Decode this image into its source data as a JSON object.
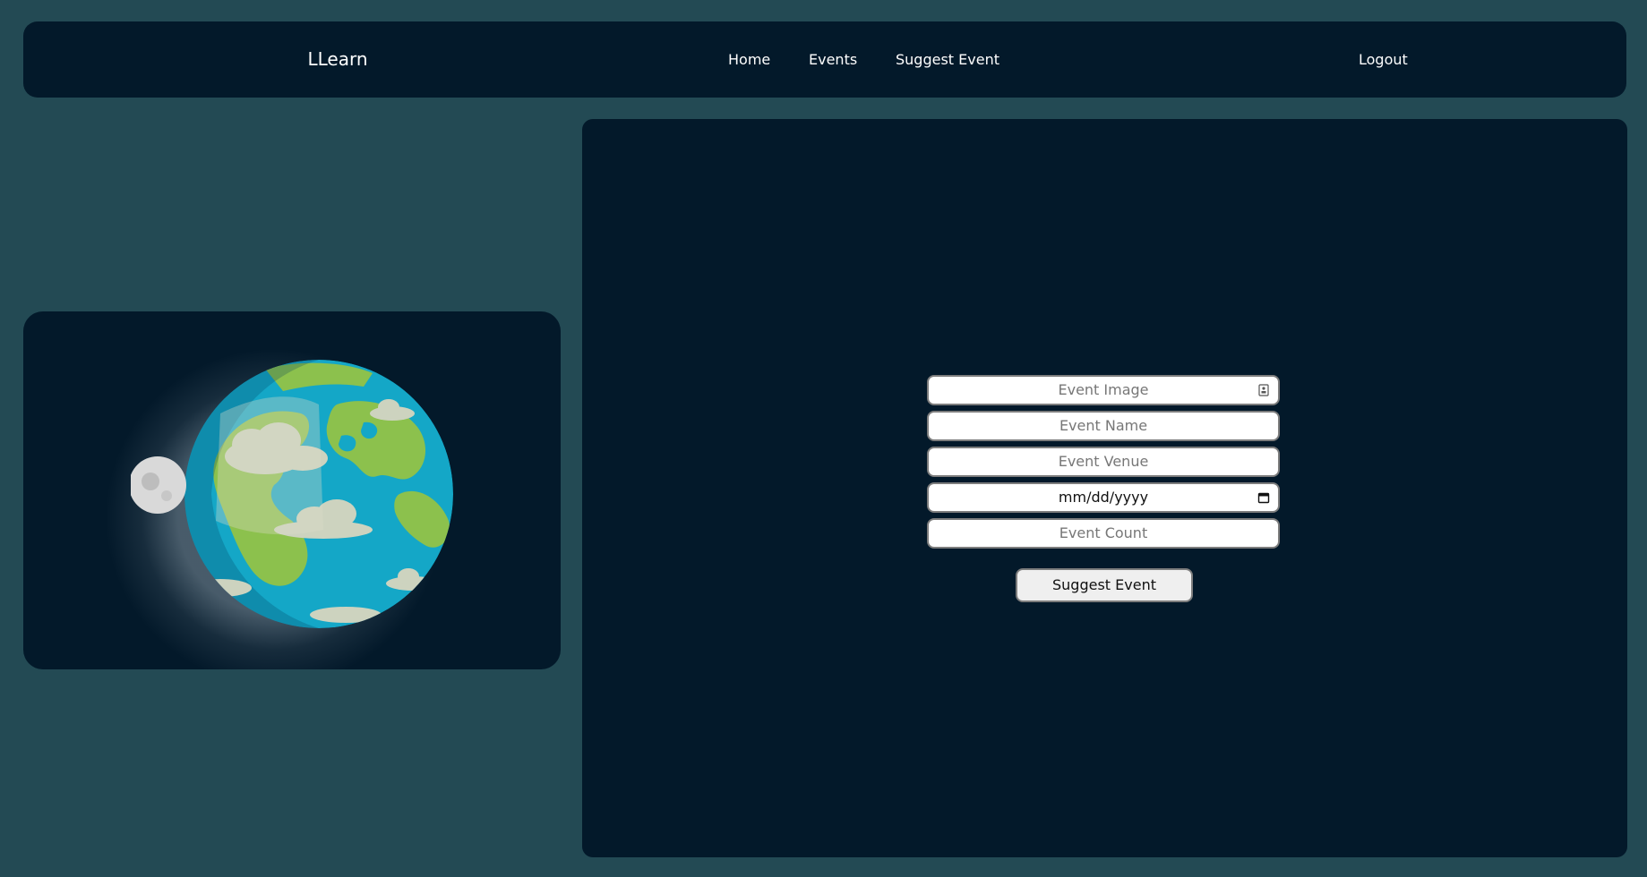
{
  "nav": {
    "brand": "LLearn",
    "links": [
      "Home",
      "Events",
      "Suggest Event"
    ],
    "logout": "Logout"
  },
  "form": {
    "image_placeholder": "Event Image",
    "name_placeholder": "Event Name",
    "venue_placeholder": "Event Venue",
    "date_placeholder": "mm/dd/yyyy",
    "count_placeholder": "Event Count",
    "submit_label": "Suggest Event"
  },
  "colors": {
    "page_background": "#234a54",
    "panel_background": "#03192a",
    "ocean": "#14a7c7",
    "land": "#8cc14d"
  },
  "icons": [
    "file-upload-icon",
    "calendar-icon"
  ]
}
